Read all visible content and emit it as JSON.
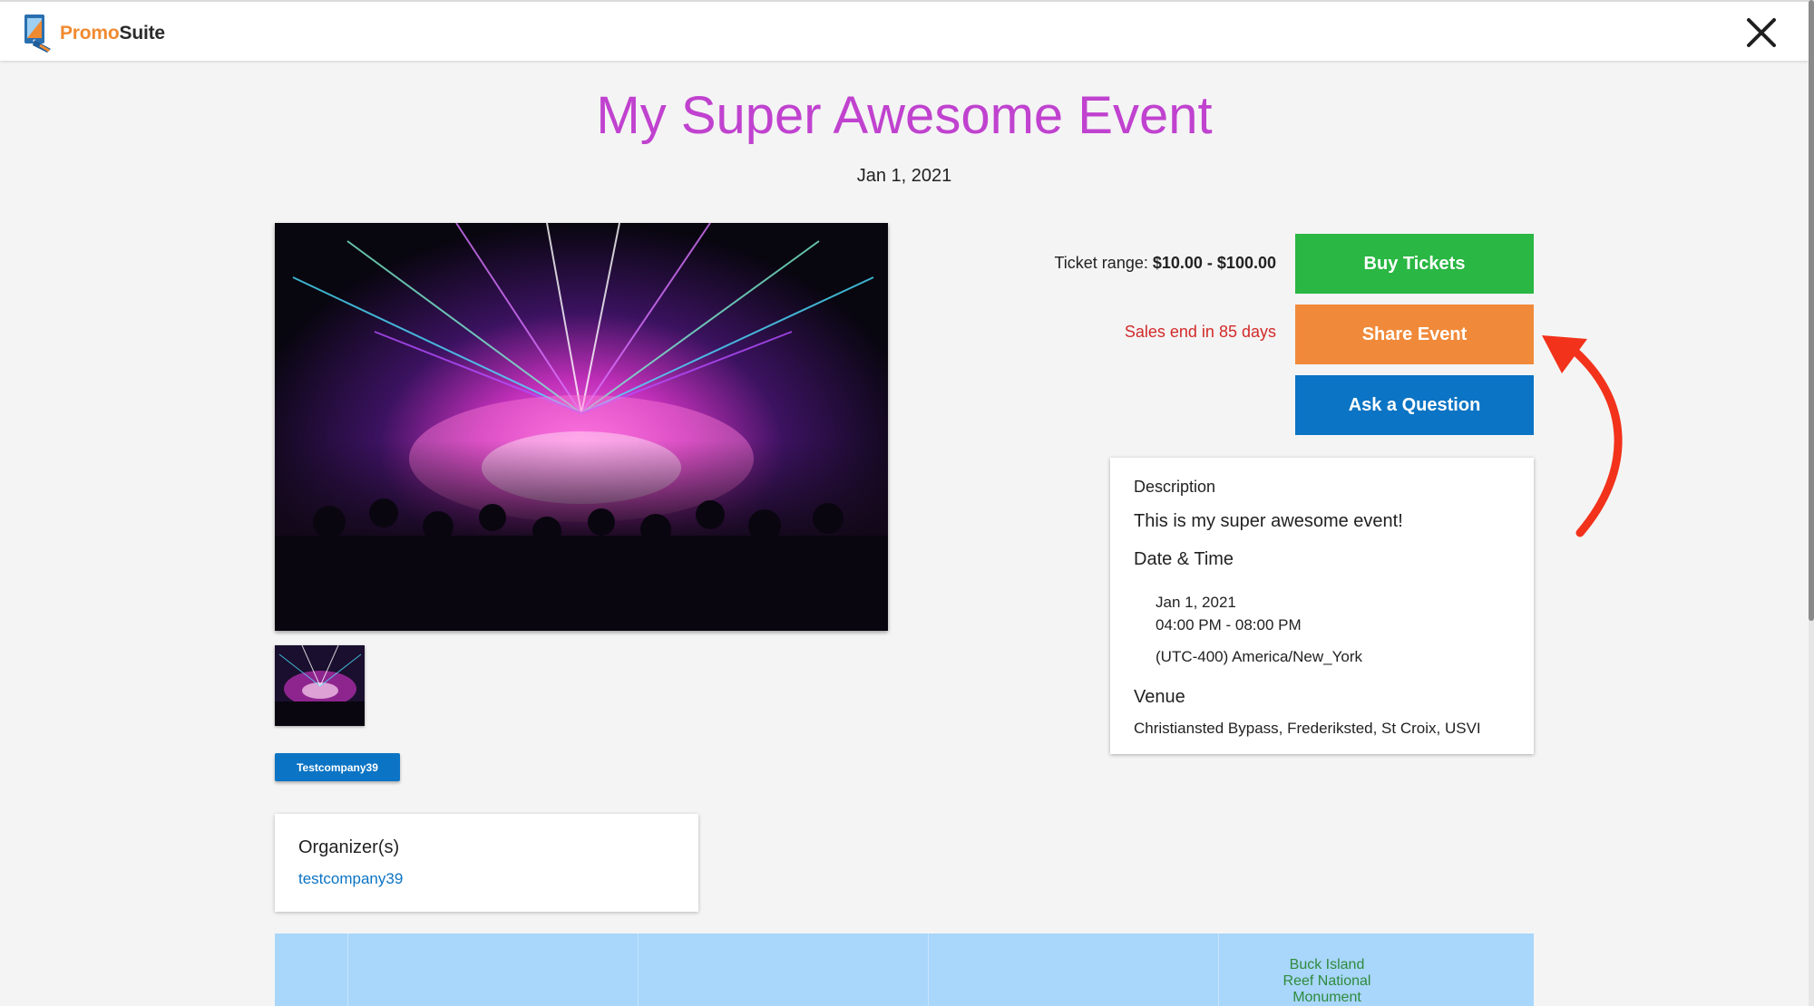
{
  "header": {
    "logo_part1": "Promo",
    "logo_part2": "Suite",
    "close_icon": "close-x-icon"
  },
  "event": {
    "title": "My Super Awesome Event",
    "date": "Jan 1, 2021"
  },
  "tickets": {
    "range_label": "Ticket range:",
    "range_value": "$10.00 - $100.00",
    "sales_end": "Sales end in 85 days"
  },
  "actions": {
    "buy": "Buy Tickets",
    "share": "Share Event",
    "ask": "Ask a Question"
  },
  "details": {
    "description_heading": "Description",
    "description": "This is my super awesome event!",
    "datetime_heading": "Date & Time",
    "date": "Jan 1, 2021",
    "time": "04:00 PM - 08:00 PM",
    "timezone": "(UTC-400) America/New_York",
    "venue_heading": "Venue",
    "venue": "Christiansted Bypass, Frederiksted, St Croix, USVI"
  },
  "company_chip": "Testcompany39",
  "organizer": {
    "heading": "Organizer(s)",
    "name": "testcompany39"
  },
  "map": {
    "label_line1": "Buck Island",
    "label_line2": "Reef National",
    "label_line3": "Monument"
  },
  "colors": {
    "title": "#c042cf",
    "buy": "#2ab743",
    "share": "#f08a3a",
    "ask": "#0b74c4",
    "sales_end": "#d22a2a",
    "annotation_arrow": "#f2321b"
  }
}
